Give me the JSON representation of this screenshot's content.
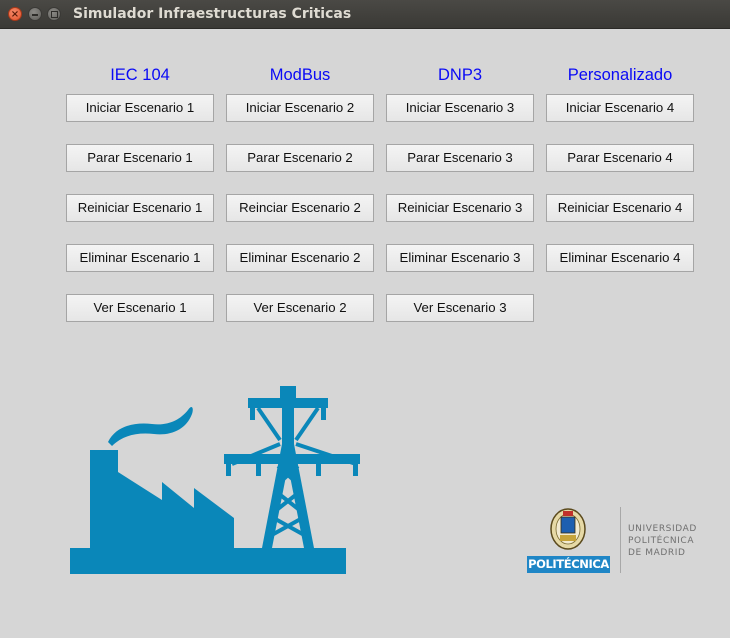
{
  "window": {
    "title": "Simulador Infraestructuras Criticas"
  },
  "columns": [
    {
      "header": "IEC 104",
      "buttons": [
        "Iniciar Escenario 1",
        "Parar Escenario 1",
        "Reiniciar Escenario 1",
        "Eliminar Escenario 1",
        "Ver Escenario 1"
      ]
    },
    {
      "header": "ModBus",
      "buttons": [
        "Iniciar Escenario 2",
        "Parar Escenario 2",
        "Reinciar Escenario 2",
        "Eliminar Escenario 2",
        "Ver Escenario 2"
      ]
    },
    {
      "header": "DNP3",
      "buttons": [
        "Iniciar Escenario 3",
        "Parar Escenario 3",
        "Reiniciar Escenario 3",
        "Eliminar Escenario 3",
        "Ver Escenario 3"
      ]
    },
    {
      "header": "Personalizado",
      "buttons": [
        "Iniciar Escenario 4",
        "Parar Escenario 4",
        "Reiniciar Escenario 4",
        "Eliminar Escenario 4"
      ]
    }
  ],
  "logo": {
    "banner": "POLITÉCNICA",
    "lines": [
      "UNIVERSIDAD",
      "POLITÉCNICA",
      "DE MADRID"
    ]
  },
  "colors": {
    "header_text": "#0a0af5",
    "illustration": "#0a87b9",
    "window_bg": "#d6d6d6"
  }
}
